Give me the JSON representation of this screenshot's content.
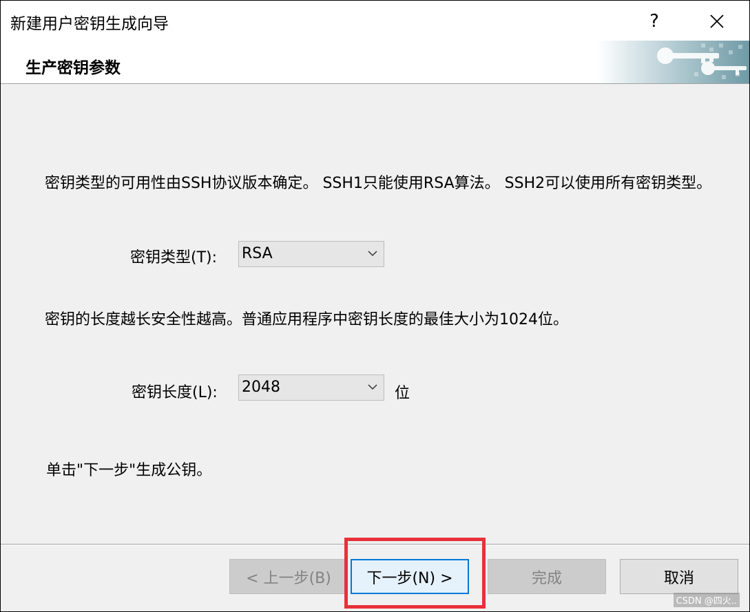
{
  "window": {
    "title": "新建用户密钥生成向导",
    "help_label": "?",
    "close_label": "✕"
  },
  "header": {
    "title": "生产密钥参数",
    "graphic": "keys-banner-icon"
  },
  "main": {
    "key_type_description": "密钥类型的可用性由SSH协议版本确定。 SSH1只能使用RSA算法。 SSH2可以使用所有密钥类型。",
    "key_type_label": "密钥类型(T):",
    "key_type_value": "RSA",
    "key_length_description": "密钥的长度越长安全性越高。普通应用程序中密钥长度的最佳大小为1024位。",
    "key_length_label": "密钥长度(L):",
    "key_length_value": "2048",
    "key_length_unit": "位",
    "instruction": "单击\"下一步\"生成公钥。"
  },
  "buttons": {
    "back": "< 上一步(B)",
    "next": "下一步(N) >",
    "finish": "完成",
    "cancel": "取消"
  },
  "annotation": {
    "highlight_color": "#e8303a",
    "highlight_target": "next-button"
  },
  "watermark": "CSDN @四火.."
}
